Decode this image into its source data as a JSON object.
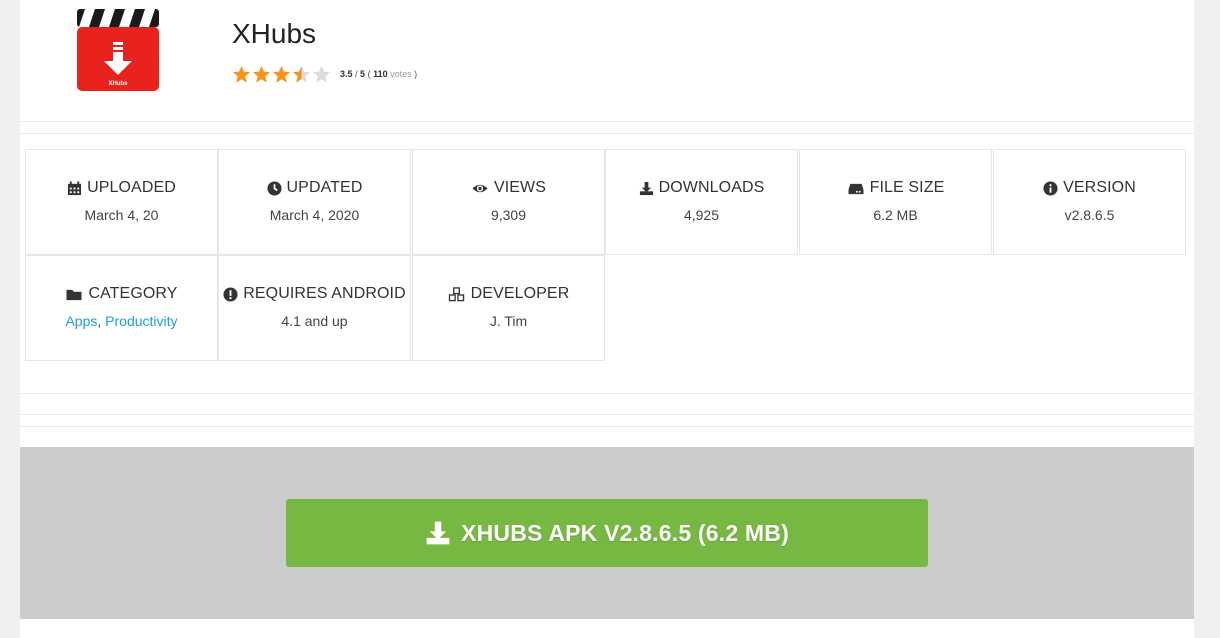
{
  "app": {
    "name": "XHubs",
    "icon_label": "XHubs",
    "rating": {
      "value": "3.5",
      "max": "5",
      "votes": "110",
      "votes_word": "votes",
      "stars_fraction": 0.7
    }
  },
  "details": [
    {
      "icon": "calendar-icon",
      "label": "UPLOADED",
      "value": "March 4, 20"
    },
    {
      "icon": "clock-icon",
      "label": "UPDATED",
      "value": "March 4, 2020"
    },
    {
      "icon": "eye-icon",
      "label": "VIEWS",
      "value": "9,309"
    },
    {
      "icon": "download-icon",
      "label": "DOWNLOADS",
      "value": "4,925"
    },
    {
      "icon": "hdd-icon",
      "label": "FILE SIZE",
      "value": "6.2 MB"
    },
    {
      "icon": "info-icon",
      "label": "VERSION",
      "value": "v2.8.6.5"
    },
    {
      "icon": "folder-icon",
      "label": "CATEGORY",
      "links": [
        "Apps",
        "Productivity"
      ]
    },
    {
      "icon": "exclamation-icon",
      "label": "REQUIRES ANDROID",
      "value": "4.1 and up"
    },
    {
      "icon": "cubes-icon",
      "label": "DEVELOPER",
      "value": "J. Tim"
    }
  ],
  "download_button": {
    "label": "XHUBS APK V2.8.6.5 (6.2 MB)",
    "icon": "download-icon"
  },
  "colors": {
    "accent_green": "#77b843",
    "link_blue": "#1a9fdc",
    "star_orange": "#f7941d",
    "icon_red": "#e8231e"
  }
}
